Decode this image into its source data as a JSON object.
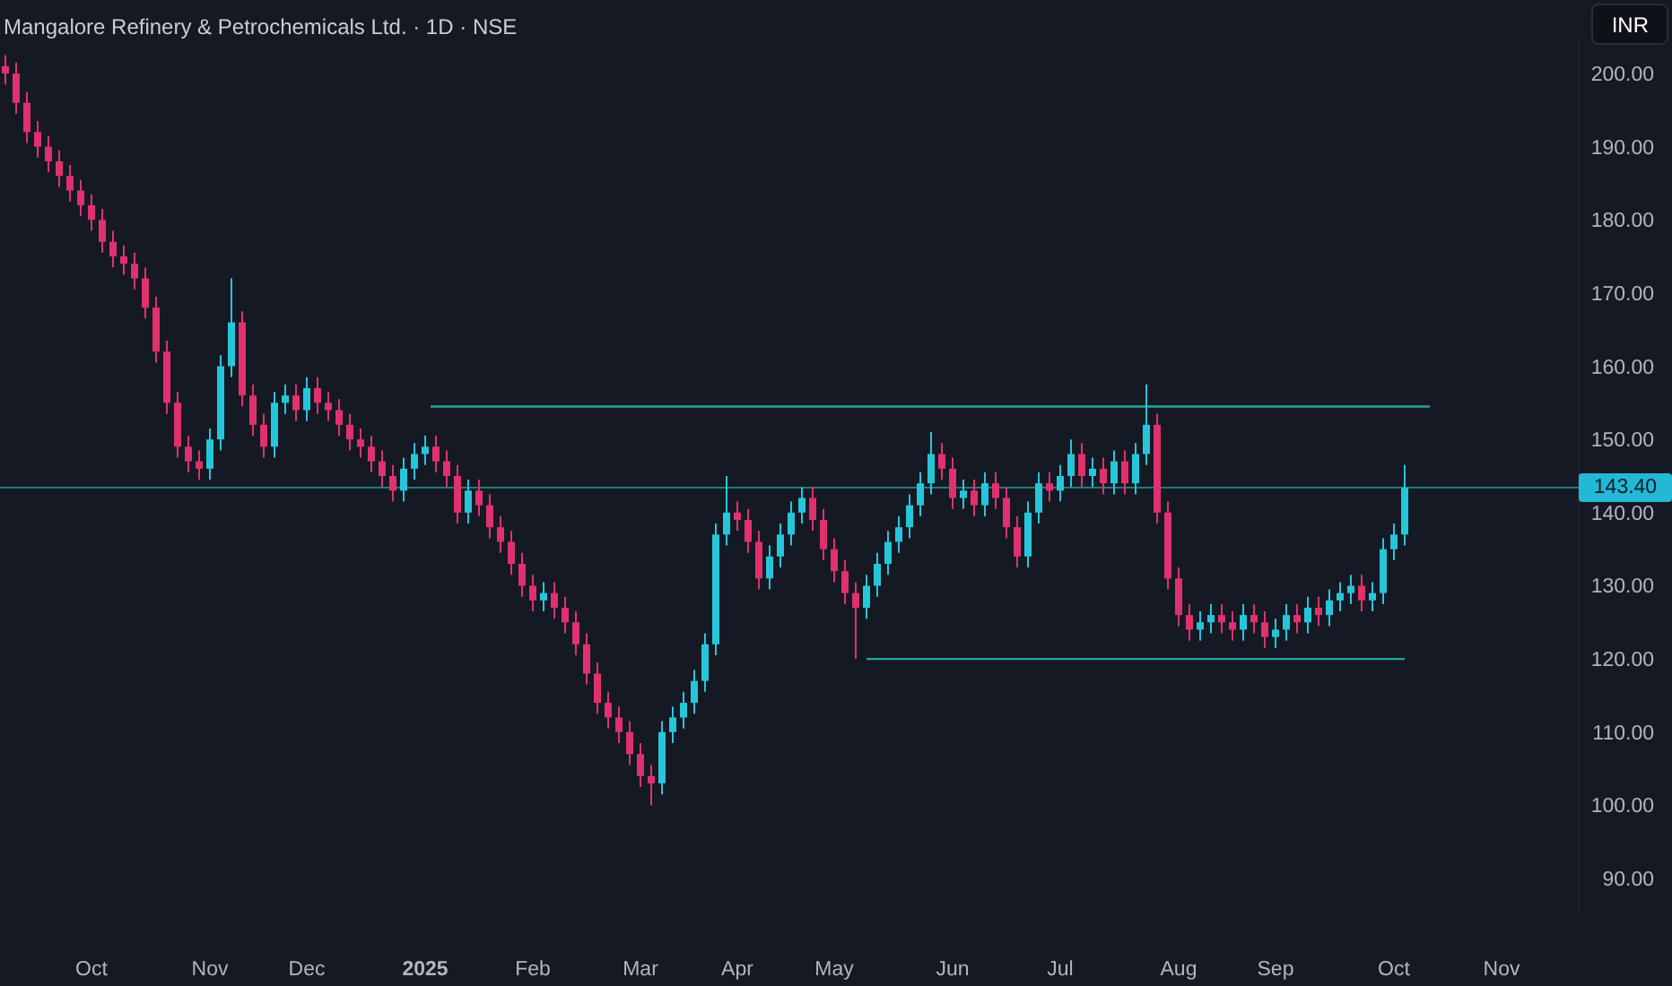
{
  "header": {
    "title": "Mangalore Refinery & Petrochemicals Ltd. · 1D · NSE",
    "currency_button": "INR"
  },
  "chart_data": {
    "type": "candlestick",
    "ylim": [
      85,
      205
    ],
    "categories": [
      null,
      null,
      null,
      null,
      null,
      null,
      null,
      null,
      "Oct",
      null,
      null,
      null,
      null,
      null,
      null,
      null,
      null,
      null,
      null,
      "Nov",
      null,
      null,
      null,
      null,
      null,
      null,
      null,
      null,
      "Dec",
      null,
      null,
      null,
      null,
      null,
      null,
      null,
      null,
      null,
      null,
      "2025",
      null,
      null,
      null,
      null,
      null,
      null,
      null,
      null,
      null,
      "Feb",
      null,
      null,
      null,
      null,
      null,
      null,
      null,
      null,
      null,
      "Mar",
      null,
      null,
      null,
      null,
      null,
      null,
      null,
      null,
      "Apr",
      null,
      null,
      null,
      null,
      null,
      null,
      null,
      null,
      "May",
      null,
      null,
      null,
      null,
      null,
      null,
      null,
      null,
      null,
      null,
      "Jun",
      null,
      null,
      null,
      null,
      null,
      null,
      null,
      null,
      null,
      "Jul",
      null,
      null,
      null,
      null,
      null,
      null,
      null,
      null,
      null,
      null,
      "Aug",
      null,
      null,
      null,
      null,
      null,
      null,
      null,
      null,
      "Sep",
      null,
      null,
      null,
      null,
      null,
      null,
      null,
      null,
      null,
      null,
      "Oct",
      null,
      null,
      null,
      null,
      null,
      null,
      null,
      null,
      null,
      "Nov"
    ],
    "yticks": [
      {
        "value": 200,
        "label": "200.00"
      },
      {
        "value": 190,
        "label": "190.00"
      },
      {
        "value": 180,
        "label": "180.00"
      },
      {
        "value": 170,
        "label": "170.00"
      },
      {
        "value": 160,
        "label": "160.00"
      },
      {
        "value": 150,
        "label": "150.00"
      },
      {
        "value": 140,
        "label": "140.00"
      },
      {
        "value": 130,
        "label": "130.00"
      },
      {
        "value": 120,
        "label": "120.00"
      },
      {
        "value": 110,
        "label": "110.00"
      },
      {
        "value": 100,
        "label": "100.00"
      },
      {
        "value": 90,
        "label": "90.00"
      }
    ],
    "ohlc": [
      [
        201,
        202.5,
        198.5,
        200
      ],
      [
        200,
        201.5,
        194.5,
        196
      ],
      [
        196,
        197.5,
        190.5,
        192
      ],
      [
        192,
        193.5,
        188.5,
        190
      ],
      [
        190,
        191.5,
        186.5,
        188
      ],
      [
        188,
        189.5,
        184.5,
        186
      ],
      [
        186,
        187.5,
        182.5,
        184
      ],
      [
        184,
        185.5,
        180.5,
        182
      ],
      [
        182,
        183.5,
        178.5,
        180
      ],
      [
        180,
        181.5,
        175.5,
        177
      ],
      [
        177,
        178.5,
        173.5,
        175
      ],
      [
        175,
        176.5,
        172.5,
        174
      ],
      [
        174,
        175.5,
        170.5,
        172
      ],
      [
        172,
        173.5,
        166.5,
        168
      ],
      [
        168,
        169.5,
        160.5,
        162
      ],
      [
        162,
        163.5,
        153.5,
        155
      ],
      [
        155,
        156.5,
        147.5,
        149
      ],
      [
        149,
        150.5,
        145.5,
        147
      ],
      [
        147,
        148.5,
        144.5,
        146
      ],
      [
        146,
        151.5,
        144.5,
        150
      ],
      [
        150,
        161.5,
        148.5,
        160
      ],
      [
        160,
        172,
        158.5,
        166
      ],
      [
        166,
        167.5,
        154.5,
        156
      ],
      [
        156,
        157.5,
        150.5,
        152
      ],
      [
        152,
        153.5,
        147.5,
        149
      ],
      [
        149,
        156.5,
        147.5,
        155
      ],
      [
        155,
        157.5,
        153.5,
        156
      ],
      [
        156,
        157.5,
        152.5,
        154
      ],
      [
        154,
        158.5,
        152.5,
        157
      ],
      [
        157,
        158.5,
        153.5,
        155
      ],
      [
        155,
        156.5,
        152.5,
        154
      ],
      [
        154,
        155.5,
        150.5,
        152
      ],
      [
        152,
        153.5,
        148.5,
        150
      ],
      [
        150,
        151.5,
        147.5,
        149
      ],
      [
        149,
        150.5,
        145.5,
        147
      ],
      [
        147,
        148.5,
        143.5,
        145
      ],
      [
        145,
        146.5,
        141.5,
        143
      ],
      [
        143,
        147.5,
        141.5,
        146
      ],
      [
        146,
        149.5,
        144.5,
        148
      ],
      [
        148,
        150.5,
        146.5,
        149
      ],
      [
        149,
        150.5,
        145.5,
        147
      ],
      [
        147,
        148.5,
        143.5,
        145
      ],
      [
        145,
        146.5,
        138.5,
        140
      ],
      [
        140,
        144.5,
        138.5,
        143
      ],
      [
        143,
        144.5,
        139.5,
        141
      ],
      [
        141,
        142.5,
        136.5,
        138
      ],
      [
        138,
        139.5,
        134.5,
        136
      ],
      [
        136,
        137.5,
        131.5,
        133
      ],
      [
        133,
        134.5,
        128.5,
        130
      ],
      [
        130,
        131.5,
        126.5,
        128
      ],
      [
        128,
        130.5,
        126.5,
        129
      ],
      [
        129,
        130.5,
        125.5,
        127
      ],
      [
        127,
        128.5,
        123.5,
        125
      ],
      [
        125,
        126.5,
        120.5,
        122
      ],
      [
        122,
        123.5,
        116.5,
        118
      ],
      [
        118,
        119.5,
        112.5,
        114
      ],
      [
        114,
        115.5,
        110.5,
        112
      ],
      [
        112,
        113.5,
        108.5,
        110
      ],
      [
        110,
        111.5,
        105.5,
        107
      ],
      [
        107,
        108.5,
        102.5,
        104
      ],
      [
        104,
        105.5,
        100,
        103
      ],
      [
        103,
        111.5,
        101.5,
        110
      ],
      [
        110,
        113.5,
        108.5,
        112
      ],
      [
        112,
        115.5,
        110.5,
        114
      ],
      [
        114,
        118.5,
        112.5,
        117
      ],
      [
        117,
        123.5,
        115.5,
        122
      ],
      [
        122,
        138.5,
        120.5,
        137
      ],
      [
        137,
        145,
        135.5,
        140
      ],
      [
        140,
        141.5,
        137.5,
        139
      ],
      [
        139,
        140.5,
        134.5,
        136
      ],
      [
        136,
        137.5,
        129.5,
        131
      ],
      [
        131,
        135.5,
        129.5,
        134
      ],
      [
        134,
        138.5,
        132.5,
        137
      ],
      [
        137,
        141.5,
        135.5,
        140
      ],
      [
        140,
        143.5,
        138.5,
        142
      ],
      [
        142,
        143.5,
        137.5,
        139
      ],
      [
        139,
        140.5,
        133.5,
        135
      ],
      [
        135,
        136.5,
        130.5,
        132
      ],
      [
        132,
        133.5,
        127.5,
        129
      ],
      [
        129,
        130.5,
        120,
        127
      ],
      [
        127,
        131.5,
        125.5,
        130
      ],
      [
        130,
        134.5,
        128.5,
        133
      ],
      [
        133,
        137.5,
        131.5,
        136
      ],
      [
        136,
        139.5,
        134.5,
        138
      ],
      [
        138,
        142.5,
        136.5,
        141
      ],
      [
        141,
        145.5,
        139.5,
        144
      ],
      [
        144,
        151,
        142.5,
        148
      ],
      [
        148,
        149.5,
        144.5,
        146
      ],
      [
        146,
        147.5,
        140.5,
        142
      ],
      [
        142,
        144.5,
        140.5,
        143
      ],
      [
        143,
        144.5,
        139.5,
        141
      ],
      [
        141,
        145.5,
        139.5,
        144
      ],
      [
        144,
        145.5,
        140.5,
        142
      ],
      [
        142,
        143.5,
        136.5,
        138
      ],
      [
        138,
        139.5,
        132.5,
        134
      ],
      [
        134,
        141.5,
        132.5,
        140
      ],
      [
        140,
        145.5,
        138.5,
        144
      ],
      [
        144,
        145.5,
        141.5,
        143
      ],
      [
        143,
        146.5,
        141.5,
        145
      ],
      [
        145,
        150,
        143.5,
        148
      ],
      [
        148,
        149.5,
        143.5,
        145
      ],
      [
        145,
        147.5,
        143.5,
        146
      ],
      [
        146,
        147.5,
        142.5,
        144
      ],
      [
        144,
        148.5,
        142.5,
        147
      ],
      [
        147,
        148.5,
        142.5,
        144
      ],
      [
        144,
        149.5,
        142.5,
        148
      ],
      [
        148,
        157.5,
        146.5,
        152
      ],
      [
        152,
        153.5,
        138.5,
        140
      ],
      [
        140,
        141.5,
        129.5,
        131
      ],
      [
        131,
        132.5,
        124.5,
        126
      ],
      [
        126,
        127.5,
        122.5,
        124
      ],
      [
        124,
        126.5,
        122.5,
        125
      ],
      [
        125,
        127.5,
        123.5,
        126
      ],
      [
        126,
        127.5,
        123.5,
        125
      ],
      [
        125,
        126.5,
        122.5,
        124
      ],
      [
        124,
        127.5,
        122.5,
        126
      ],
      [
        126,
        127.5,
        123.5,
        125
      ],
      [
        125,
        126.5,
        121.5,
        123
      ],
      [
        123,
        125.5,
        121.5,
        124
      ],
      [
        124,
        127.5,
        122.5,
        126
      ],
      [
        126,
        127.5,
        123.5,
        125
      ],
      [
        125,
        128.5,
        123.5,
        127
      ],
      [
        127,
        128.5,
        124.5,
        126
      ],
      [
        126,
        129.5,
        124.5,
        128
      ],
      [
        128,
        130.5,
        126.5,
        129
      ],
      [
        129,
        131.5,
        127.5,
        130
      ],
      [
        130,
        131.5,
        126.5,
        128
      ],
      [
        128,
        130.5,
        126.5,
        129
      ],
      [
        129,
        136.5,
        127.5,
        135
      ],
      [
        135,
        138.5,
        133.5,
        137
      ],
      [
        137,
        146.5,
        135.5,
        143.4
      ],
      null,
      null,
      null,
      null,
      null,
      null,
      null,
      null,
      null
    ],
    "ref_lines": [
      {
        "axis": "y",
        "value": 154.5
      },
      {
        "axis": "y",
        "value": 120
      },
      {
        "axis": "y",
        "value": 143.4,
        "label": "143.40"
      }
    ]
  }
}
